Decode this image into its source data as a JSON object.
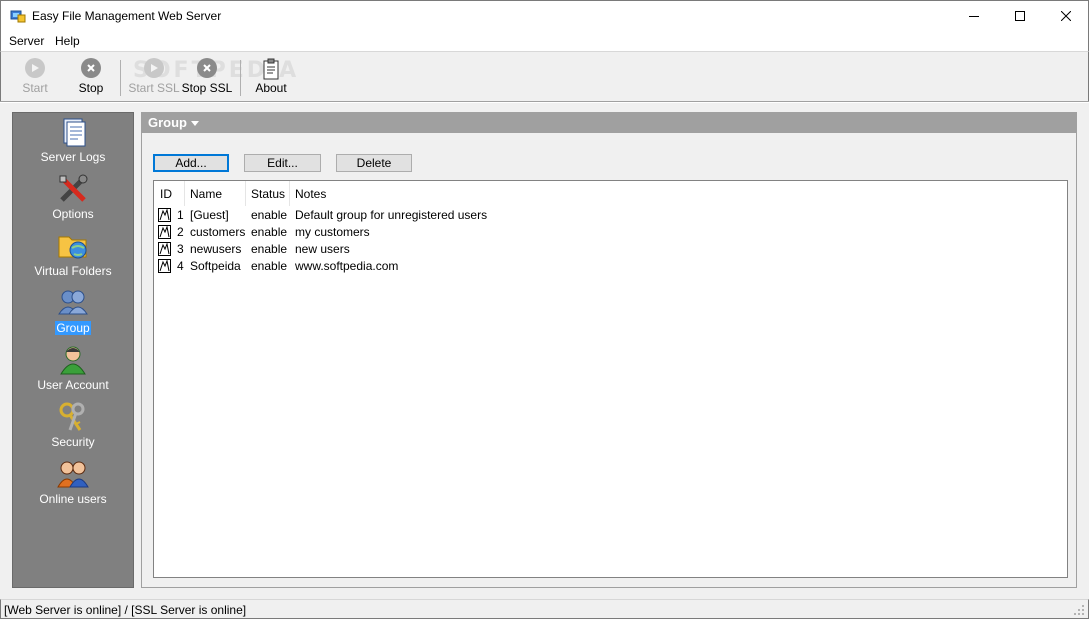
{
  "window": {
    "title": "Easy File Management Web Server"
  },
  "menu": {
    "items": [
      "Server",
      "Help"
    ]
  },
  "toolbar": {
    "start_label": "Start",
    "stop_label": "Stop",
    "start_ssl_label": "Start SSL",
    "stop_ssl_label": "Stop SSL",
    "about_label": "About",
    "watermark": "SOFTPEDIA"
  },
  "sidebar": {
    "items": [
      {
        "label": "Server Logs",
        "icon": "server-logs-icon"
      },
      {
        "label": "Options",
        "icon": "options-icon"
      },
      {
        "label": "Virtual Folders",
        "icon": "virtual-folders-icon"
      },
      {
        "label": "Group",
        "icon": "group-icon",
        "active": true
      },
      {
        "label": "User Account",
        "icon": "user-account-icon"
      },
      {
        "label": "Security",
        "icon": "security-icon"
      },
      {
        "label": "Online users",
        "icon": "online-users-icon"
      }
    ]
  },
  "panel": {
    "title": "Group",
    "buttons": {
      "add": "Add...",
      "edit": "Edit...",
      "delete": "Delete"
    },
    "columns": [
      "ID",
      "Name",
      "Status",
      "Notes"
    ],
    "rows": [
      {
        "id": "1",
        "name": "[Guest]",
        "status": "enable",
        "notes": "Default group for unregistered users"
      },
      {
        "id": "2",
        "name": "customers",
        "status": "enable",
        "notes": "my customers"
      },
      {
        "id": "3",
        "name": "newusers",
        "status": "enable",
        "notes": "new users"
      },
      {
        "id": "4",
        "name": "Softpeida",
        "status": "enable",
        "notes": "www.softpedia.com"
      }
    ]
  },
  "status": {
    "text": "[Web Server is online] / [SSL Server is online]"
  },
  "colors": {
    "sidebar_bg": "#808080",
    "header_bg": "#a0a0a0",
    "selection": "#3399ff",
    "focus_border": "#0078d7"
  }
}
